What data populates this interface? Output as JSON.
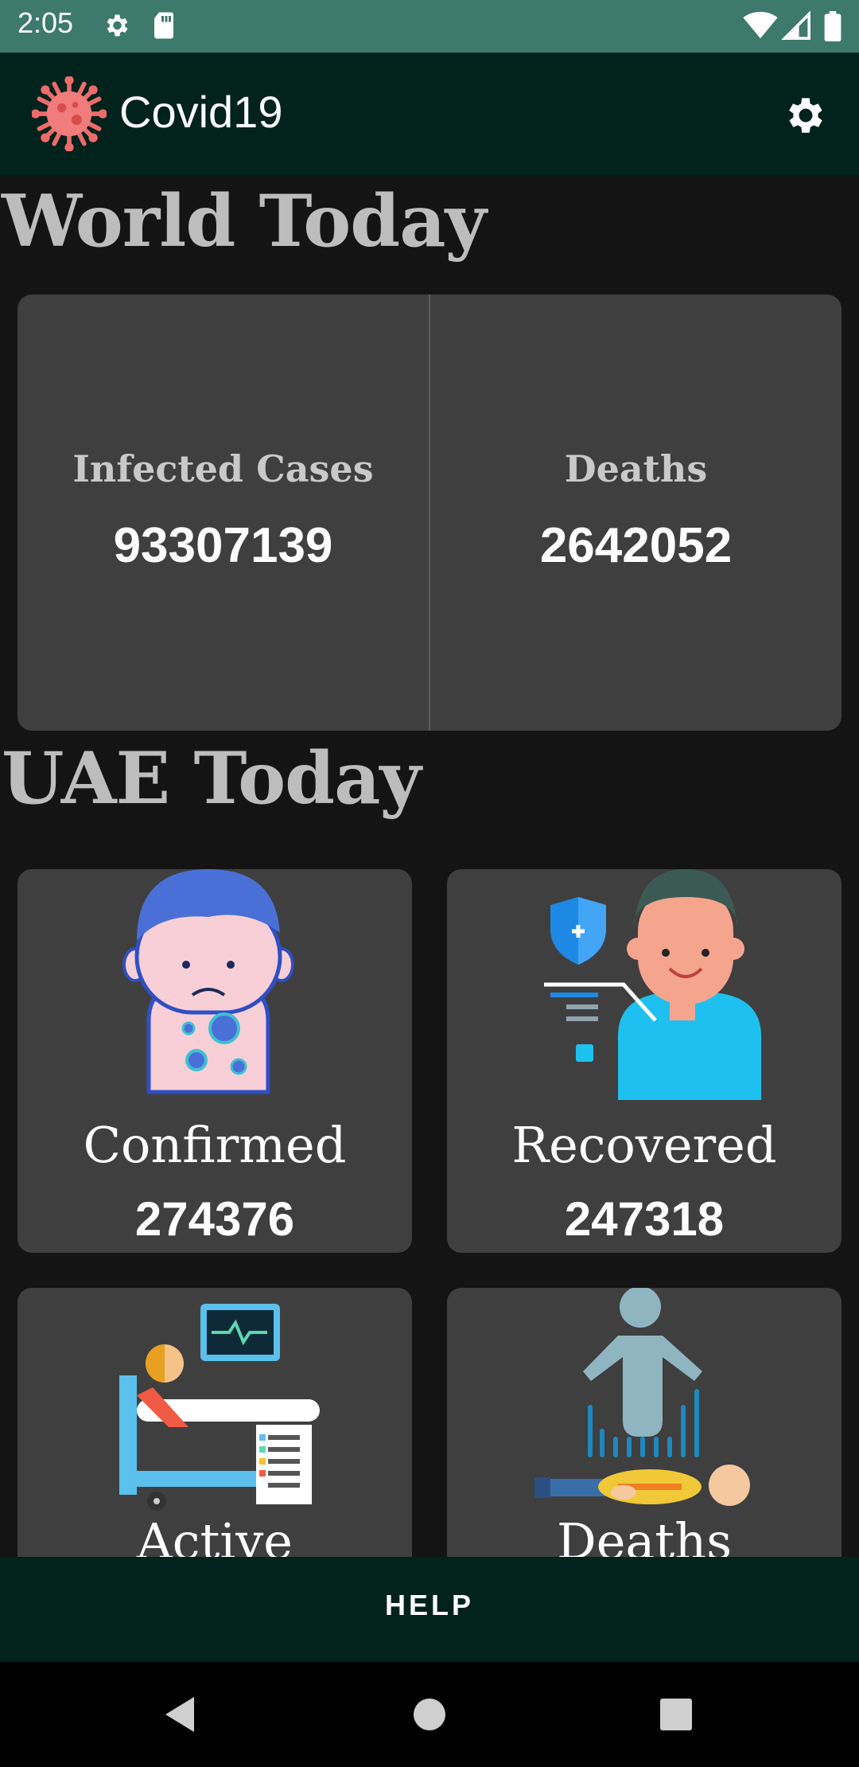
{
  "status_bar": {
    "time": "2:05"
  },
  "app_bar": {
    "title": "Covid19"
  },
  "world": {
    "heading": "World Today",
    "infected_label": "Infected Cases",
    "infected_value": "93307139",
    "deaths_label": "Deaths",
    "deaths_value": "2642052"
  },
  "uae": {
    "heading": "UAE Today",
    "cards": [
      {
        "label": "Confirmed",
        "value": "274376"
      },
      {
        "label": "Recovered",
        "value": "247318"
      },
      {
        "label": "Active"
      },
      {
        "label": "Deaths"
      }
    ]
  },
  "help_button": "HELP",
  "icons": {
    "status": [
      "settings-icon",
      "sd-card-icon",
      "wifi-icon",
      "cell-signal-icon",
      "battery-icon"
    ],
    "app": [
      "virus-logo-icon",
      "settings-gear-icon"
    ],
    "nav": [
      "back-icon",
      "home-icon",
      "recents-icon"
    ]
  },
  "colors": {
    "status_bar": "#3d7a6c",
    "app_bar": "#01231c",
    "background": "#141414",
    "card": "#3f3f3f",
    "heading": "#bdbdbd"
  }
}
